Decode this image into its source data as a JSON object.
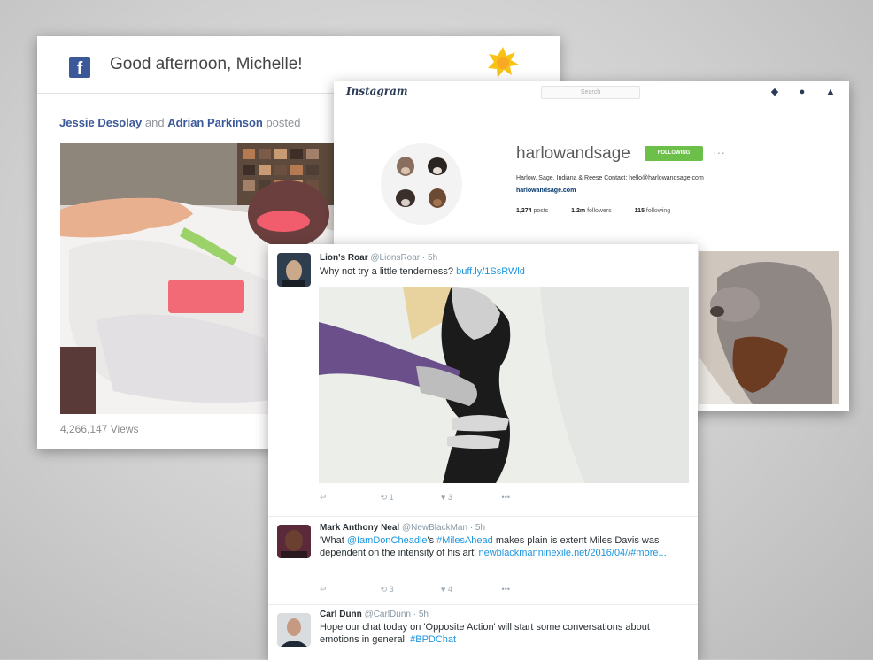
{
  "facebook": {
    "logo_letter": "f",
    "greeting": "Good afternoon, Michelle!",
    "poster_a": "Jessie Desolay",
    "poster_join": "and",
    "poster_b": "Adrian Parkinson",
    "poster_action": "posted",
    "views": "4,266,147 Views"
  },
  "instagram": {
    "logo": "Instagram",
    "search_placeholder": "Search",
    "username": "harlowandsage",
    "follow_label": "FOLLOWING",
    "more": "···",
    "bio": "Harlow, Sage, Indiana & Reese Contact: hello@harlowandsage.com",
    "website": "harlowandsage.com",
    "posts_count": "1,274",
    "posts_label": "posts",
    "followers_count": "1.2m",
    "followers_label": "followers",
    "following_count": "115",
    "following_label": "following"
  },
  "twitter": {
    "tweets": [
      {
        "name": "Lion's Roar",
        "handle": "@LionsRoar · 5h",
        "text": "Why not try a little tenderness?",
        "link": "buff.ly/1SsRWld",
        "retweets": "1",
        "likes": "3"
      },
      {
        "name": "Mark Anthony Neal",
        "handle": "@NewBlackMan · 5h",
        "text_parts": [
          "'What ",
          "@IamDonCheadle",
          "'s ",
          "#MilesAhead",
          " makes plain is extent Miles Davis was dependent on the intensity of his art' ",
          "newblackmanninexile.net/2016/04/",
          "/#more..."
        ],
        "retweets": "3",
        "likes": "4"
      },
      {
        "name": "Carl Dunn",
        "handle": "@CarlDunn · 5h",
        "text": "Hope our chat today on 'Opposite Action' will start some conversations about emotions in general.",
        "hashtag": "#BPDChat"
      }
    ],
    "more": "•••"
  },
  "colors": {
    "facebook_blue": "#3b5998",
    "instagram_navy": "#2a3b55",
    "follow_green": "#6cc04a",
    "twitter_link": "#1b95e0"
  }
}
